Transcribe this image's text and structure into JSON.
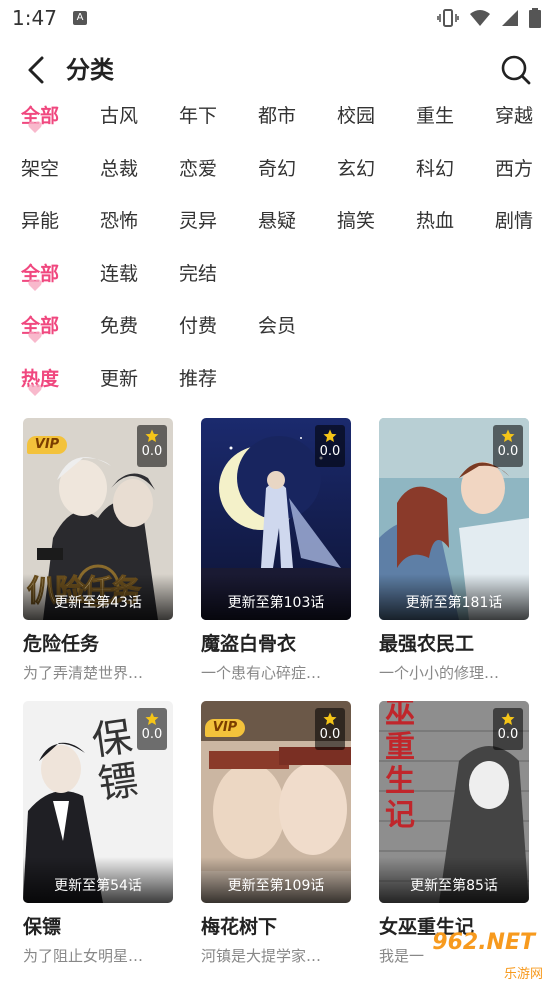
{
  "status": {
    "time": "1:47",
    "notification_letter": "A"
  },
  "header": {
    "title": "分类"
  },
  "filters": [
    [
      "全部",
      "古风",
      "年下",
      "都市",
      "校园",
      "重生",
      "穿越"
    ],
    [
      "架空",
      "总裁",
      "恋爱",
      "奇幻",
      "玄幻",
      "科幻",
      "西方"
    ],
    [
      "异能",
      "恐怖",
      "灵异",
      "悬疑",
      "搞笑",
      "热血",
      "剧情"
    ],
    [
      "全部",
      "连载",
      "完结"
    ],
    [
      "全部",
      "免费",
      "付费",
      "会员"
    ],
    [
      "热度",
      "更新",
      "推荐"
    ]
  ],
  "comics": [
    {
      "title": "危险任务",
      "desc": "为了弄清楚世界…",
      "update": "更新至第43话",
      "rating": "0.0",
      "vip": "VIP",
      "cover_text": "仈险任务"
    },
    {
      "title": "魔盗白骨衣",
      "desc": "一个患有心碎症…",
      "update": "更新至第103话",
      "rating": "0.0",
      "vip": "",
      "cover_text": ""
    },
    {
      "title": "最强农民工",
      "desc": "一个小小的修理…",
      "update": "更新至第181话",
      "rating": "0.0",
      "vip": "",
      "cover_text": ""
    },
    {
      "title": "保镖",
      "desc": "为了阻止女明星…",
      "update": "更新至第54话",
      "rating": "0.0",
      "vip": "",
      "cover_text": "保镖"
    },
    {
      "title": "梅花树下",
      "desc": "河镇是大提学家…",
      "update": "更新至第109话",
      "rating": "0.0",
      "vip": "VIP",
      "cover_text": ""
    },
    {
      "title": "女巫重生记",
      "desc": "我是一",
      "update": "更新至第85话",
      "rating": "0.0",
      "vip": "",
      "cover_text": "巫重生记"
    }
  ],
  "watermark": {
    "site": "962.NET",
    "name": "乐游网"
  },
  "colors": {
    "accent": "#f0487f",
    "text": "#222222",
    "muted": "#888888"
  }
}
